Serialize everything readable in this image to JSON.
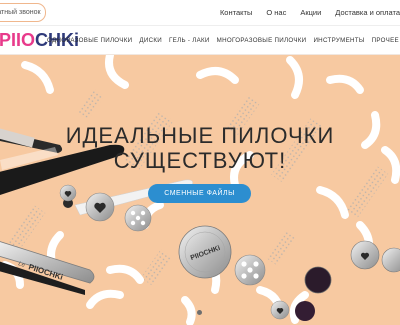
{
  "topbar": {
    "callback_label": "ратный звонок",
    "links": [
      "Контакты",
      "О нас",
      "Акции",
      "Доставка и оплата"
    ]
  },
  "navbar": {
    "logo_part1": "PIIO",
    "logo_part2": "CHKi",
    "menu": [
      "ОДНОРАЗОВЫЕ ПИЛОЧКИ",
      "ДИСКИ",
      "ГЕЛЬ - ЛАКИ",
      "МНОГОРАЗОВЫЕ ПИЛОЧКИ",
      "ИНСТРУМЕНТЫ",
      "ПРОЧЕЕ"
    ]
  },
  "hero": {
    "title_line1": "ИДЕАЛЬНЫЕ ПИЛОЧКИ",
    "title_line2": "СУЩЕСТВУЮТ!",
    "cta_label": "СМЕННЫЕ ФАЙЛЫ",
    "file_brand": "PIIOCHKi",
    "file_script": "Le",
    "disc_brand": "PIIOCHKi"
  },
  "colors": {
    "accent_pink": "#e83a8b",
    "accent_navy": "#2f3a7a",
    "button_blue": "#2c8ed0",
    "hero_bg": "#f7c9a1"
  },
  "carousel": {
    "current": 1,
    "total": 1
  }
}
